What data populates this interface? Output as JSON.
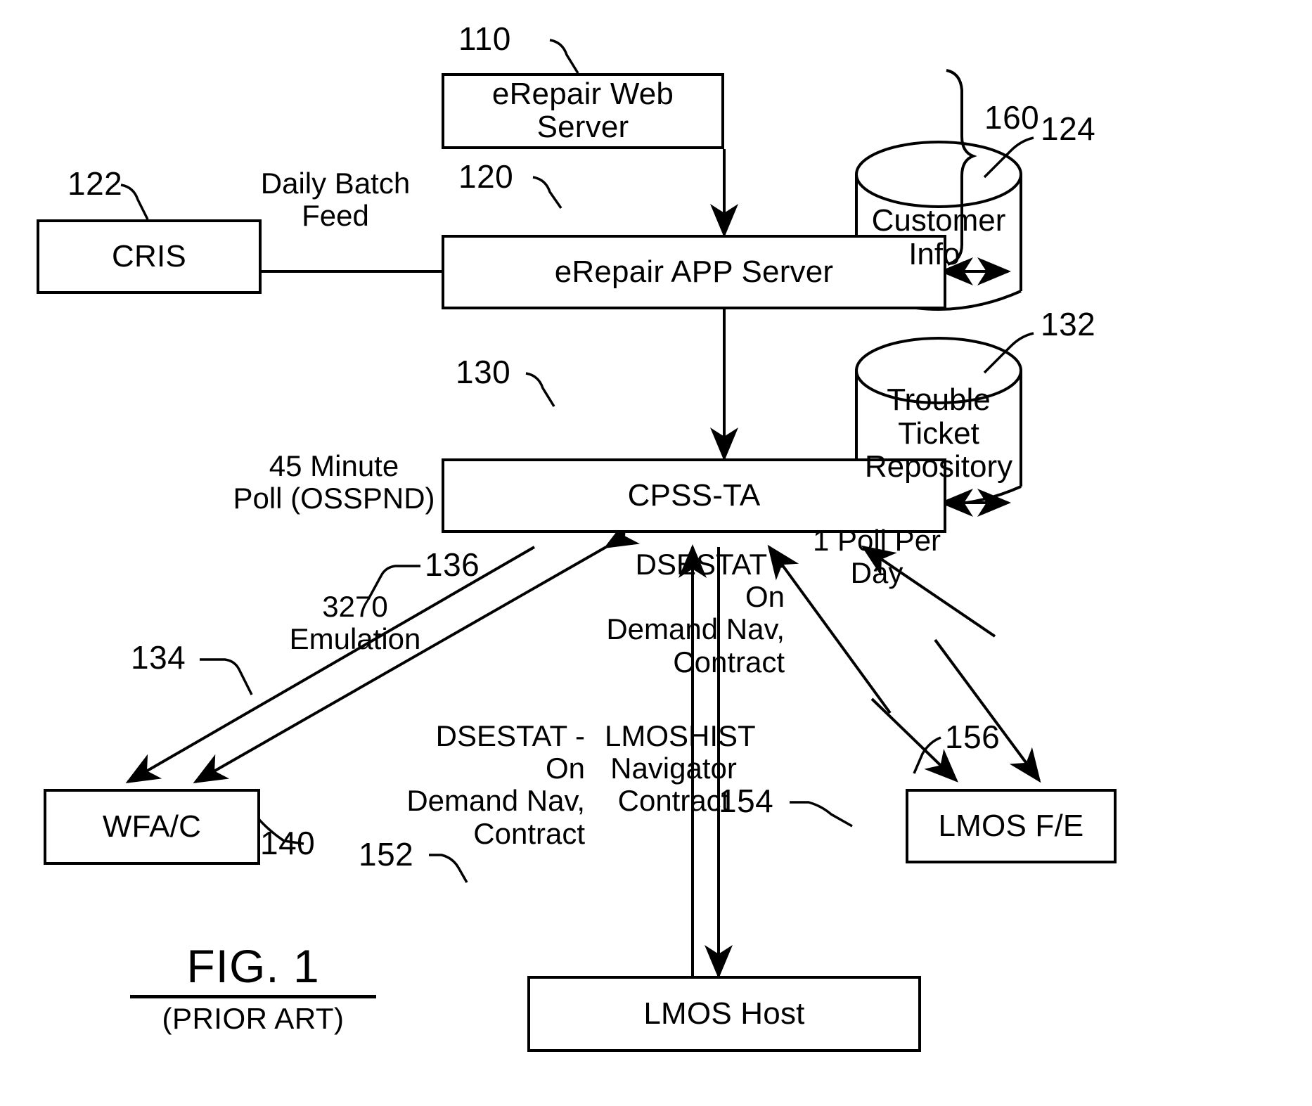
{
  "figure": {
    "title": "FIG. 1",
    "subtitle": "(PRIOR ART)"
  },
  "nodes": {
    "erepair_web_server": {
      "label": "eRepair Web Server",
      "ref": "110"
    },
    "erepair_app_server": {
      "label": "eRepair APP Server",
      "ref": "120"
    },
    "cris": {
      "label": "CRIS",
      "ref": "122"
    },
    "cpss_ta": {
      "label": "CPSS-TA",
      "ref": "130"
    },
    "wfa_c": {
      "label": "WFA/C",
      "ref": "140"
    },
    "lmos_host": {
      "label": "LMOS Host",
      "ref": "152"
    },
    "lmos_fe": {
      "label": "LMOS F/E",
      "ref": "154"
    }
  },
  "datastores": {
    "customer_info": {
      "label": "Customer\nInfo.",
      "ref": "124"
    },
    "trouble_ticket_repository": {
      "label": "Trouble\nTicket\nRepository",
      "ref": "132"
    }
  },
  "brace": {
    "ref": "160"
  },
  "edges": [
    {
      "name": "cris-to-app-server",
      "label": "Daily Batch\nFeed"
    },
    {
      "name": "cpss-to-wfac-poll",
      "label": "45 Minute\nPoll (OSSPND)",
      "ref": "134"
    },
    {
      "name": "cpss-to-wfac-emulation",
      "label": "3270\nEmulation",
      "ref": "136"
    },
    {
      "name": "lmos-host-dsestat",
      "label": "DSESTAT - On\nDemand Nav,\nContract"
    },
    {
      "name": "lmos-host-lmoshist",
      "label": "LMOSHIST\nNavigator\nContract"
    },
    {
      "name": "lmos-fe-dsestat",
      "label": "DSESTAT - On\nDemand Nav,\nContract"
    },
    {
      "name": "lmos-fe-poll",
      "label": "1 Poll Per\nDay",
      "ref": "156"
    }
  ],
  "colors": {
    "ink": "#000000",
    "paper": "#ffffff"
  }
}
